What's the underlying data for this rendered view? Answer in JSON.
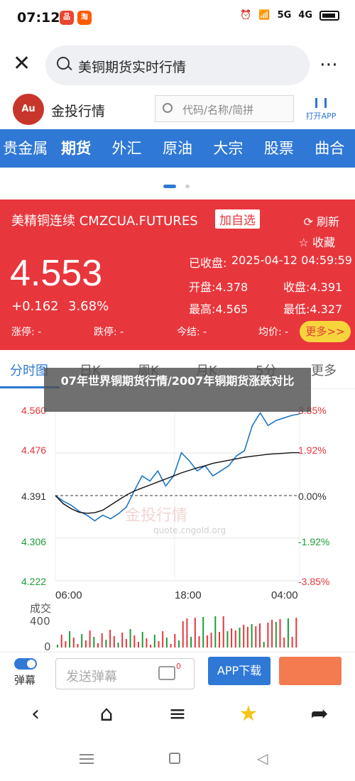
{
  "status_bar": {
    "time": "07:12",
    "badges": [
      "品",
      "淘"
    ],
    "network_5g": "5G",
    "network_4g": "4G"
  },
  "search": {
    "query": "美铜期货实时行情"
  },
  "header": {
    "brand": "金投行情",
    "logo_text": "Au",
    "search_placeholder": "代码/名称/简拼",
    "open_app_label": "打开APP"
  },
  "categories": [
    "贵金属",
    "期货",
    "外汇",
    "原油",
    "大宗",
    "股票",
    "曲合"
  ],
  "active_category": "期货",
  "quote": {
    "name": "美精铜连续 CMZCUA.FUTURES",
    "add_fav": "加自选",
    "refresh": "刷新",
    "collect": "收藏",
    "price": "4.553",
    "change": "+0.162",
    "change_pct": "3.68%",
    "prev_close_label": "已收盘:",
    "prev_close_time": "2025-04-12 04:59:59",
    "open": "开盘:4.378",
    "prev_close": "收盘:4.391",
    "high": "最高:4.565",
    "low": "最低:4.327",
    "limit_up": "涨停: -",
    "limit_down": "跌停: -",
    "settle": "今结: -",
    "avg": "均价: -",
    "more": "更多>>"
  },
  "tabs": [
    "分时图",
    "日K",
    "周K",
    "月K",
    "5分",
    "更多"
  ],
  "overlay_title": "07年世界铜期货行情/2007年铜期货涨跌对比",
  "chart_data": {
    "type": "line",
    "y_labels_left": [
      "4.560",
      "4.476",
      "4.391",
      "4.306",
      "4.222"
    ],
    "y_labels_right": [
      "3.85%",
      "1.92%",
      "0.00%",
      "-1.92%",
      "-3.85%"
    ],
    "x_labels": [
      "06:00",
      "18:00",
      "04:00"
    ],
    "ylim": [
      4.222,
      4.56
    ],
    "series": [
      {
        "values": [
          4.391,
          4.38,
          4.372,
          4.36,
          4.352,
          4.341,
          4.352,
          4.345,
          4.355,
          4.368,
          4.4,
          4.43,
          4.42,
          4.44,
          4.41,
          4.43,
          4.476,
          4.46,
          4.44,
          4.45,
          4.43,
          4.44,
          4.45,
          4.47,
          4.48,
          4.53,
          4.555,
          4.53,
          4.54,
          4.545,
          4.55,
          4.553
        ]
      },
      {
        "values": [
          4.391,
          4.375,
          4.365,
          4.358,
          4.356,
          4.357,
          4.362,
          4.372,
          4.382,
          4.392,
          4.4,
          4.406,
          4.412,
          4.418,
          4.424,
          4.43,
          4.436,
          4.441,
          4.446,
          4.45,
          4.455,
          4.458,
          4.461,
          4.464,
          4.467,
          4.469,
          4.471,
          4.473,
          4.474,
          4.475,
          4.476,
          4.476
        ]
      }
    ],
    "colors": {
      "price": "#1e77c8",
      "avg": "#111111",
      "up": "#e8363d",
      "down": "#1d9b3a"
    }
  },
  "watermark": {
    "text": "金投行情",
    "url": "quote.cngold.org"
  },
  "volume": {
    "label": "成交",
    "ticks": [
      "400",
      "0"
    ]
  },
  "bottom_bar": {
    "danmu_label": "弹幕",
    "danmu_placeholder": "发送弹幕",
    "msg_count": "0",
    "app_download": "APP下载"
  }
}
